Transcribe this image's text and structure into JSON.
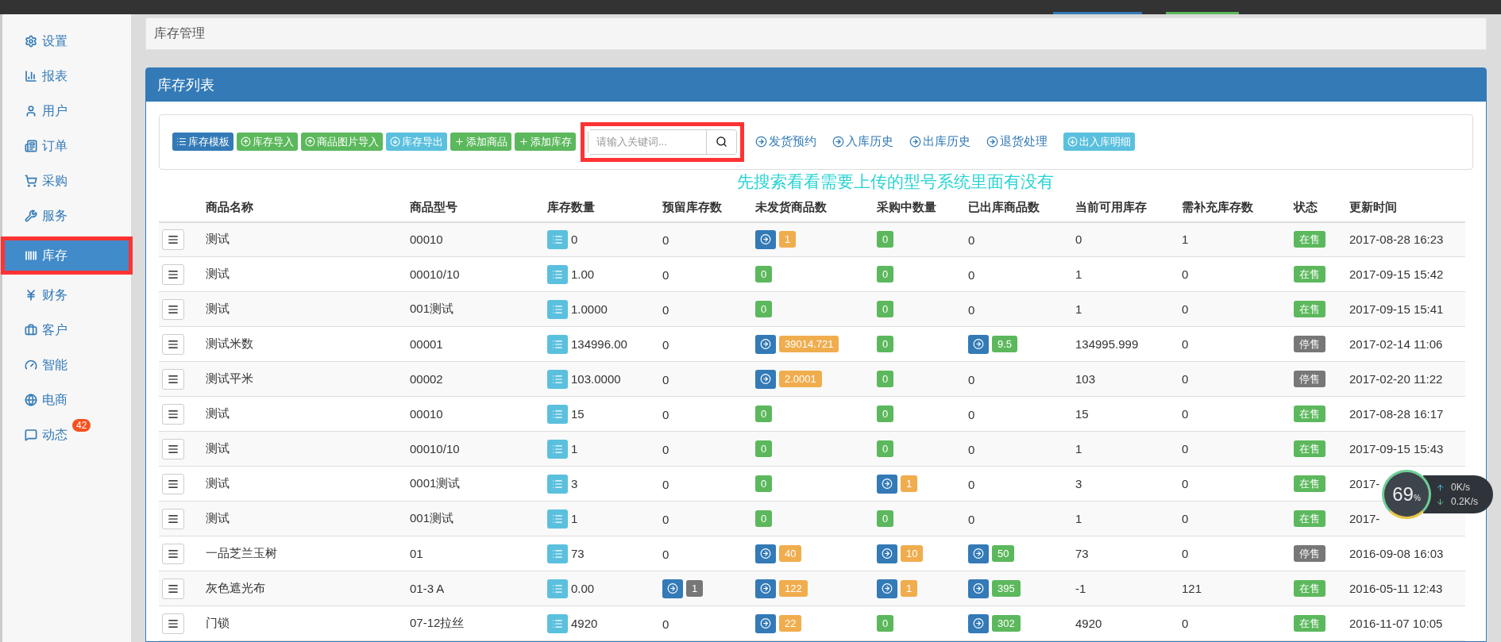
{
  "sidebar": {
    "items": [
      {
        "label": "设置",
        "selected": false
      },
      {
        "label": "报表",
        "selected": false
      },
      {
        "label": "用户",
        "selected": false
      },
      {
        "label": "订单",
        "selected": false
      },
      {
        "label": "采购",
        "selected": false
      },
      {
        "label": "服务",
        "selected": false
      },
      {
        "label": "库存",
        "selected": true
      },
      {
        "label": "财务",
        "selected": false
      },
      {
        "label": "客户",
        "selected": false
      },
      {
        "label": "智能",
        "selected": false
      },
      {
        "label": "电商",
        "selected": false
      },
      {
        "label": "动态",
        "selected": false,
        "badge": "42"
      }
    ]
  },
  "breadcrumb": "库存管理",
  "panel": {
    "title": "库存列表",
    "toolbar": {
      "buttons": [
        {
          "label": "库存模板",
          "kind": "primary"
        },
        {
          "label": "库存导入",
          "kind": "success"
        },
        {
          "label": "商品图片导入",
          "kind": "success"
        },
        {
          "label": "库存导出",
          "kind": "info"
        },
        {
          "label": "添加商品",
          "kind": "success"
        },
        {
          "label": "添加库存",
          "kind": "success"
        }
      ],
      "search": {
        "placeholder": "请输入关键词..."
      },
      "links": [
        "发货预约",
        "入库历史",
        "出库历史",
        "退货处理"
      ],
      "detail_button": {
        "label": "出入库明细",
        "kind": "info"
      }
    },
    "annotation": "先搜索看看需要上传的型号系统里面有没有",
    "table": {
      "columns": [
        "商品名称",
        "商品型号",
        "库存数量",
        "预留库存数",
        "未发货商品数",
        "采购中数量",
        "已出库商品数",
        "当前可用库存",
        "需补充库存数",
        "状态",
        "更新时间"
      ],
      "rows": [
        {
          "name": "测试",
          "model": "00010",
          "stock": "0",
          "reserved": {
            "text": "0",
            "kind": "plain",
            "link": false
          },
          "unshipped": {
            "text": "1",
            "kind": "warning",
            "link": true
          },
          "purchasing": {
            "text": "0",
            "kind": "success",
            "link": false
          },
          "shipped": {
            "text": "0",
            "kind": "plain",
            "link": false
          },
          "available": "0",
          "replenish": "1",
          "status": {
            "text": "在售",
            "kind": "success"
          },
          "updated": "2017-08-28 16:23"
        },
        {
          "name": "测试",
          "model": "00010/10",
          "stock": "1.00",
          "reserved": {
            "text": "0",
            "kind": "plain",
            "link": false
          },
          "unshipped": {
            "text": "0",
            "kind": "success",
            "link": false
          },
          "purchasing": {
            "text": "0",
            "kind": "success",
            "link": false
          },
          "shipped": {
            "text": "0",
            "kind": "plain",
            "link": false
          },
          "available": "1",
          "replenish": "0",
          "status": {
            "text": "在售",
            "kind": "success"
          },
          "updated": "2017-09-15 15:42"
        },
        {
          "name": "测试",
          "model": "001测试",
          "stock": "1.0000",
          "reserved": {
            "text": "0",
            "kind": "plain",
            "link": false
          },
          "unshipped": {
            "text": "0",
            "kind": "success",
            "link": false
          },
          "purchasing": {
            "text": "0",
            "kind": "success",
            "link": false
          },
          "shipped": {
            "text": "0",
            "kind": "plain",
            "link": false
          },
          "available": "1",
          "replenish": "0",
          "status": {
            "text": "在售",
            "kind": "success"
          },
          "updated": "2017-09-15 15:41"
        },
        {
          "name": "测试米数",
          "model": "00001",
          "stock": "134996.00",
          "reserved": {
            "text": "0",
            "kind": "plain",
            "link": false
          },
          "unshipped": {
            "text": "39014.721",
            "kind": "warning",
            "link": true
          },
          "purchasing": {
            "text": "0",
            "kind": "success",
            "link": false
          },
          "shipped": {
            "text": "9.5",
            "kind": "success",
            "link": true
          },
          "available": "134995.999",
          "replenish": "0",
          "status": {
            "text": "停售",
            "kind": "default"
          },
          "updated": "2017-02-14 11:06"
        },
        {
          "name": "测试平米",
          "model": "00002",
          "stock": "103.0000",
          "reserved": {
            "text": "0",
            "kind": "plain",
            "link": false
          },
          "unshipped": {
            "text": "2.0001",
            "kind": "warning",
            "link": true
          },
          "purchasing": {
            "text": "0",
            "kind": "success",
            "link": false
          },
          "shipped": {
            "text": "0",
            "kind": "plain",
            "link": false
          },
          "available": "103",
          "replenish": "0",
          "status": {
            "text": "停售",
            "kind": "default"
          },
          "updated": "2017-02-20 11:22"
        },
        {
          "name": "测试",
          "model": "00010",
          "stock": "15",
          "reserved": {
            "text": "0",
            "kind": "plain",
            "link": false
          },
          "unshipped": {
            "text": "0",
            "kind": "success",
            "link": false
          },
          "purchasing": {
            "text": "0",
            "kind": "success",
            "link": false
          },
          "shipped": {
            "text": "0",
            "kind": "plain",
            "link": false
          },
          "available": "15",
          "replenish": "0",
          "status": {
            "text": "在售",
            "kind": "success"
          },
          "updated": "2017-08-28 16:17"
        },
        {
          "name": "测试",
          "model": "00010/10",
          "stock": "1",
          "reserved": {
            "text": "0",
            "kind": "plain",
            "link": false
          },
          "unshipped": {
            "text": "0",
            "kind": "success",
            "link": false
          },
          "purchasing": {
            "text": "0",
            "kind": "success",
            "link": false
          },
          "shipped": {
            "text": "0",
            "kind": "plain",
            "link": false
          },
          "available": "1",
          "replenish": "0",
          "status": {
            "text": "在售",
            "kind": "success"
          },
          "updated": "2017-09-15 15:43"
        },
        {
          "name": "测试",
          "model": "0001测试",
          "stock": "3",
          "reserved": {
            "text": "0",
            "kind": "plain",
            "link": false
          },
          "unshipped": {
            "text": "0",
            "kind": "success",
            "link": false
          },
          "purchasing": {
            "text": "1",
            "kind": "warning",
            "link": true
          },
          "shipped": {
            "text": "0",
            "kind": "plain",
            "link": false
          },
          "available": "3",
          "replenish": "0",
          "status": {
            "text": "在售",
            "kind": "success"
          },
          "updated": "2017-"
        },
        {
          "name": "测试",
          "model": "001测试",
          "stock": "1",
          "reserved": {
            "text": "0",
            "kind": "plain",
            "link": false
          },
          "unshipped": {
            "text": "0",
            "kind": "success",
            "link": false
          },
          "purchasing": {
            "text": "0",
            "kind": "success",
            "link": false
          },
          "shipped": {
            "text": "0",
            "kind": "plain",
            "link": false
          },
          "available": "1",
          "replenish": "0",
          "status": {
            "text": "在售",
            "kind": "success"
          },
          "updated": "2017-"
        },
        {
          "name": "一品芝兰玉树",
          "model": "01",
          "stock": "73",
          "reserved": {
            "text": "0",
            "kind": "plain",
            "link": false
          },
          "unshipped": {
            "text": "40",
            "kind": "warning",
            "link": true
          },
          "purchasing": {
            "text": "10",
            "kind": "warning",
            "link": true
          },
          "shipped": {
            "text": "50",
            "kind": "success",
            "link": true
          },
          "available": "73",
          "replenish": "0",
          "status": {
            "text": "停售",
            "kind": "default"
          },
          "updated": "2016-09-08 16:03"
        },
        {
          "name": "灰色遮光布",
          "model": "01-3 A",
          "stock": "0.00",
          "reserved": {
            "text": "1",
            "kind": "default",
            "link": true
          },
          "unshipped": {
            "text": "122",
            "kind": "warning",
            "link": true
          },
          "purchasing": {
            "text": "1",
            "kind": "warning",
            "link": true
          },
          "shipped": {
            "text": "395",
            "kind": "success",
            "link": true
          },
          "available": "-1",
          "replenish": "121",
          "status": {
            "text": "在售",
            "kind": "success"
          },
          "updated": "2016-05-11 12:43"
        },
        {
          "name": "门锁",
          "model": "07-12拉丝",
          "stock": "4920",
          "reserved": {
            "text": "0",
            "kind": "plain",
            "link": false
          },
          "unshipped": {
            "text": "22",
            "kind": "warning",
            "link": true
          },
          "purchasing": {
            "text": "0",
            "kind": "success",
            "link": false
          },
          "shipped": {
            "text": "302",
            "kind": "success",
            "link": true
          },
          "available": "4920",
          "replenish": "0",
          "status": {
            "text": "在售",
            "kind": "success"
          },
          "updated": "2016-11-07 10:05"
        }
      ]
    }
  },
  "speed_widget": {
    "percent": "69$_{%}$",
    "upload": "0K/s",
    "download": "0.2K/s"
  }
}
